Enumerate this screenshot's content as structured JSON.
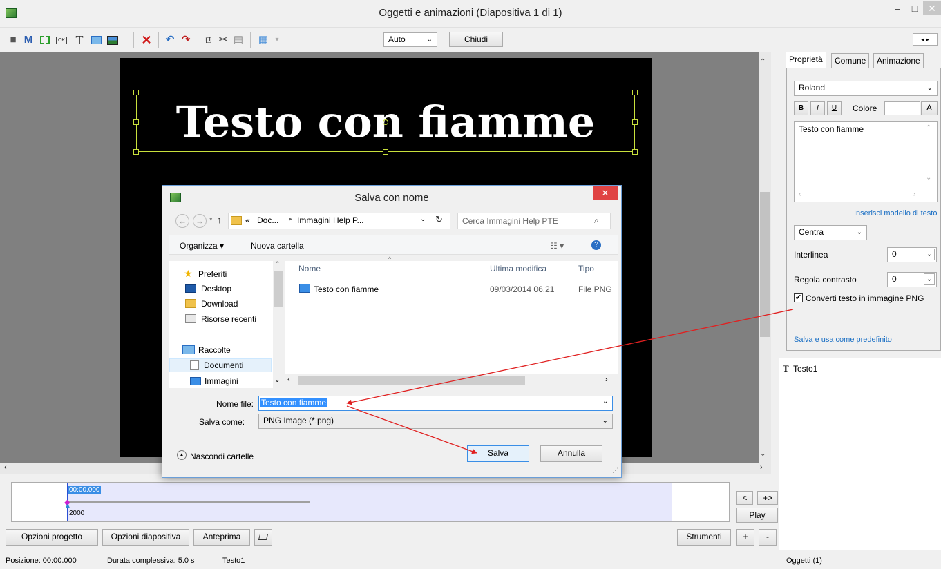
{
  "window": {
    "title": "Oggetti e animazioni  (Diapositiva 1 di 1)"
  },
  "toolbar": {
    "letter_m": "M",
    "letter_t": "T",
    "ok_label": "OK",
    "zoom_value": "Auto",
    "close_label": "Chiudi"
  },
  "slide": {
    "text": "Testo con fiamme"
  },
  "properties": {
    "tabs": [
      "Proprietà",
      "Comune",
      "Animazione"
    ],
    "font": "Roland",
    "bold": "B",
    "italic": "I",
    "underline": "U",
    "color_label": "Colore",
    "color_btn": "A",
    "text_content": "Testo con fiamme",
    "template_link": "Inserisci modello di testo",
    "align_value": "Centra",
    "line_spacing_label": "Interlinea",
    "line_spacing_value": "0",
    "contrast_label": "Regola contrasto",
    "contrast_value": "0",
    "convert_label": "Converti testo in immagine PNG",
    "save_default_link": "Salva e usa come predefinito"
  },
  "objects": {
    "items": [
      {
        "icon": "T",
        "label": "Testo1"
      }
    ],
    "footer": "Oggetti (1)"
  },
  "dialog": {
    "title": "Salva con nome",
    "path_prefix": "«",
    "path_doc": "Doc...",
    "path_folder": "Immagini Help P...",
    "search_placeholder": "Cerca Immagini Help PTE",
    "organize": "Organizza ▾",
    "new_folder": "Nuova cartella",
    "nav": {
      "favorites": "Preferiti",
      "desktop": "Desktop",
      "download": "Download",
      "recent": "Risorse recenti",
      "libraries": "Raccolte",
      "documents": "Documenti",
      "images": "Immagini"
    },
    "columns": {
      "name": "Nome",
      "modified": "Ultima modifica",
      "type": "Tipo"
    },
    "files": [
      {
        "name": "Testo con fiamme",
        "modified": "09/03/2014 06.21",
        "type": "File PNG"
      }
    ],
    "filename_label": "Nome file:",
    "filename_value": "Testo con fiamme",
    "saveas_label": "Salva come:",
    "saveas_value": "PNG Image (*.png)",
    "hide_folders": "Nascondi cartelle",
    "save_btn": "Salva",
    "cancel_btn": "Annulla"
  },
  "timeline": {
    "time": "00:00.000",
    "duration_ms": "2000",
    "btn_back": "<",
    "btn_plusarrow": "+>",
    "btn_play": "Play",
    "btn_plus": "+",
    "btn_minus": "-"
  },
  "bottom": {
    "project_options": "Opzioni progetto",
    "slide_options": "Opzioni diapositiva",
    "preview": "Anteprima",
    "tools": "Strumenti"
  },
  "status": {
    "position": "Posizione: 00:00.000",
    "duration": "Durata complessiva: 5.0 s",
    "object": "Testo1"
  }
}
